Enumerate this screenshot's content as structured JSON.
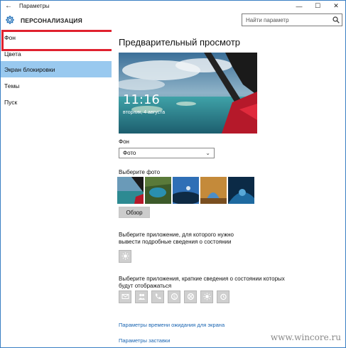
{
  "window": {
    "title": "Параметры",
    "controls": {
      "minimize": "—",
      "maximize": "☐",
      "close": "✕"
    },
    "back_icon": "←"
  },
  "header": {
    "title": "ПЕРСОНАЛИЗАЦИЯ",
    "icon": "gear-icon"
  },
  "search": {
    "placeholder": "Найти параметр",
    "icon": "search-icon"
  },
  "sidebar": {
    "items": [
      {
        "label": "Фон",
        "active": false
      },
      {
        "label": "Цвета",
        "active": false
      },
      {
        "label": "Экран блокировки",
        "active": true
      },
      {
        "label": "Темы",
        "active": false
      },
      {
        "label": "Пуск",
        "active": false
      }
    ]
  },
  "main": {
    "preview_title": "Предварительный просмотр",
    "preview": {
      "time": "11:16",
      "date": "вторник, 4 августа"
    },
    "background_label": "Фон",
    "background_value": "Фото",
    "choose_photo_label": "Выберите фото",
    "browse_label": "Обзор",
    "detailed_status_label": "Выберите приложение, для которого нужно вывести подробные сведения о состоянии",
    "quick_status_label": "Выберите приложения, краткие сведения о состоянии которых будут отображаться",
    "quick_status_apps": [
      "mail-icon",
      "people-icon",
      "phone-icon",
      "skype-icon",
      "xbox-icon",
      "weather-icon",
      "alarm-icon"
    ],
    "detailed_status_app": "weather-icon",
    "link_timeout": "Параметры времени ожидания для экрана",
    "link_screensaver": "Параметры заставки"
  },
  "watermark": "www.wincore.ru",
  "colors": {
    "accent": "#1f6fb8",
    "selection": "#99c9ef",
    "highlight_frame": "#e0212e",
    "link": "#1a65b2"
  }
}
